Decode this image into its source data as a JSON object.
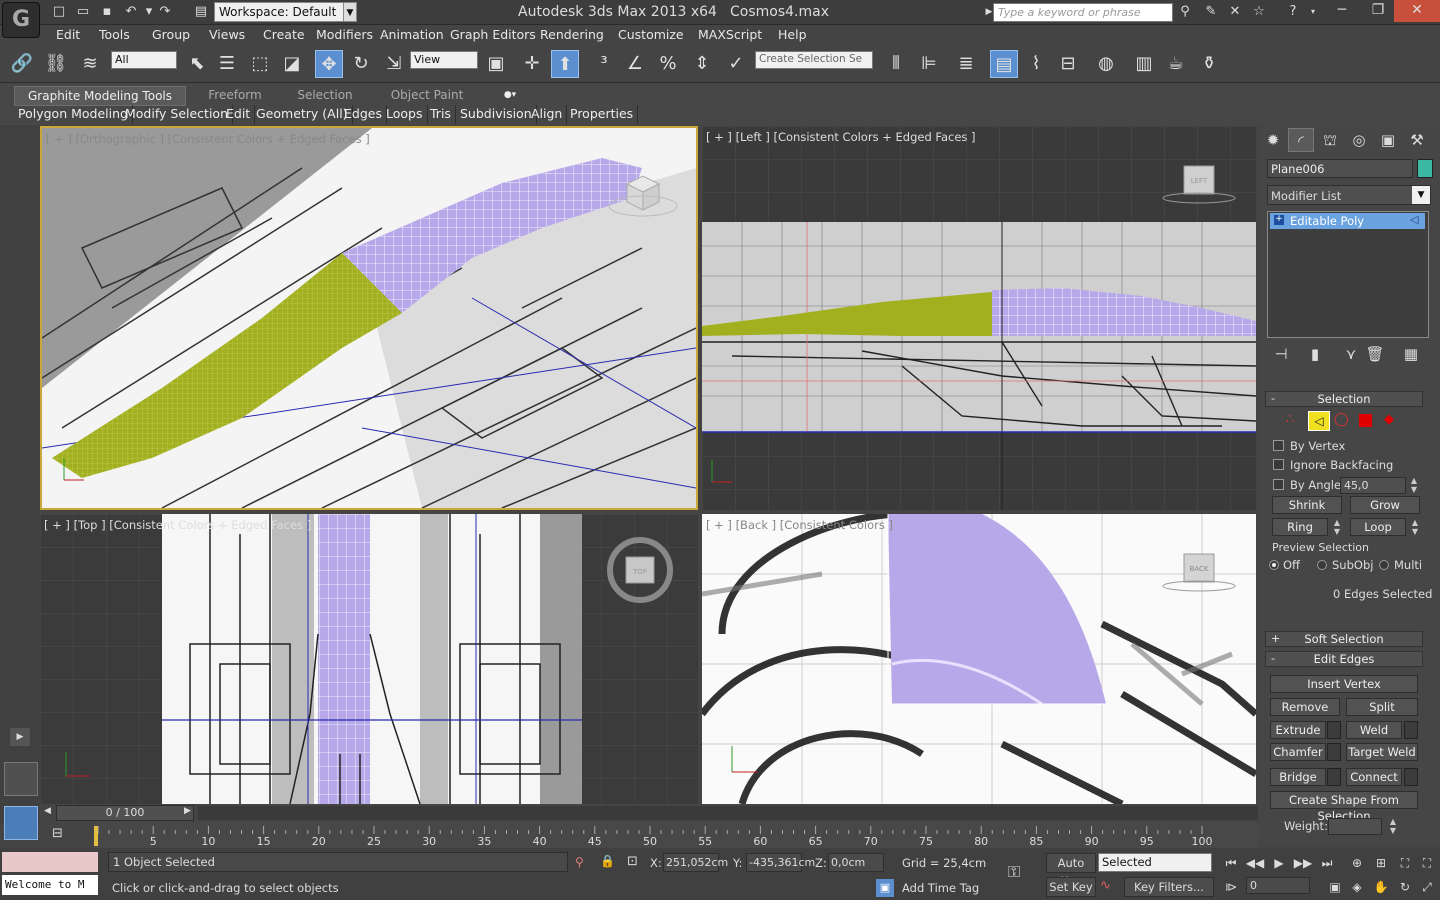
{
  "window": {
    "app_title": "Autodesk 3ds Max  2013 x64",
    "file_name": "Cosmos4.max",
    "workspace": "Workspace: Default",
    "search_placeholder": "Type a keyword or phrase"
  },
  "menu": [
    "Edit",
    "Tools",
    "Group",
    "Views",
    "Create",
    "Modifiers",
    "Animation",
    "Graph Editors",
    "Rendering",
    "Customize",
    "MAXScript",
    "Help"
  ],
  "toolbar": {
    "selection_filter": "All",
    "reference_coord": "View",
    "named_selection_placeholder": "Create Selection Se"
  },
  "ribbon": {
    "tabs": [
      "Graphite Modeling Tools",
      "Freeform",
      "Selection",
      "Object Paint"
    ],
    "subtabs": [
      "Polygon Modeling",
      "Modify Selection",
      "Edit",
      "Geometry (All)",
      "Edges",
      "Loops",
      "Tris",
      "Subdivision",
      "Align",
      "Properties"
    ]
  },
  "viewports": {
    "ortho": "[ + ] [Orthographic ] [Consistent Colors + Edged Faces ]",
    "left": "[ + ] [Left ] [Consistent Colors + Edged Faces ]",
    "top": "[ + ] [Top ] [Consistent Colors + Edged Faces ]",
    "back": "[ + ] [Back ] [Consistent Colors ]",
    "cube_left": "LEFT",
    "cube_top": "TOP",
    "cube_back": "BACK"
  },
  "colors": {
    "selection_green": "#a2b020",
    "mesh_lavender": "#b7a9e9",
    "accent_blue": "#5b8fd0",
    "viewport_border": "#c9a83a"
  },
  "command_panel": {
    "object_name": "Plane006",
    "modifier_list": "Modifier List",
    "stack_item": "Editable Poly",
    "selection": {
      "title": "Selection",
      "by_vertex": "By Vertex",
      "ignore_backfacing": "Ignore Backfacing",
      "by_angle": "By Angle:",
      "angle_value": "45,0",
      "shrink": "Shrink",
      "grow": "Grow",
      "ring": "Ring",
      "loop": "Loop",
      "preview_title": "Preview Selection",
      "preview_off": "Off",
      "preview_subobj": "SubObj",
      "preview_multi": "Multi",
      "status": "0 Edges Selected"
    },
    "soft_selection": "Soft Selection",
    "edit_edges": {
      "title": "Edit Edges",
      "insert_vertex": "Insert Vertex",
      "remove": "Remove",
      "split": "Split",
      "extrude": "Extrude",
      "weld": "Weld",
      "chamfer": "Chamfer",
      "target_weld": "Target Weld",
      "bridge": "Bridge",
      "connect": "Connect",
      "create_shape": "Create Shape From Selection",
      "weight": "Weight:"
    }
  },
  "timeline": {
    "slider": "0 / 100",
    "ticks": [
      "5",
      "10",
      "15",
      "20",
      "25",
      "30",
      "35",
      "40",
      "45",
      "50",
      "55",
      "60",
      "65",
      "70",
      "75",
      "80",
      "85",
      "90",
      "95",
      "100"
    ]
  },
  "status": {
    "maxscript_text": "Welcome to M",
    "selection_count": "1 Object Selected",
    "prompt": "Click or click-and-drag to select objects",
    "x_label": "X:",
    "x_value": "251,052cm",
    "y_label": "Y:",
    "y_value": "-435,361cm",
    "z_label": "Z:",
    "z_value": "0,0cm",
    "grid": "Grid = 25,4cm",
    "add_time_tag": "Add Time Tag",
    "auto_key": "Auto Key",
    "set_key": "Set Key",
    "key_mode": "Selected",
    "key_filters": "Key Filters...",
    "frame": "0"
  }
}
